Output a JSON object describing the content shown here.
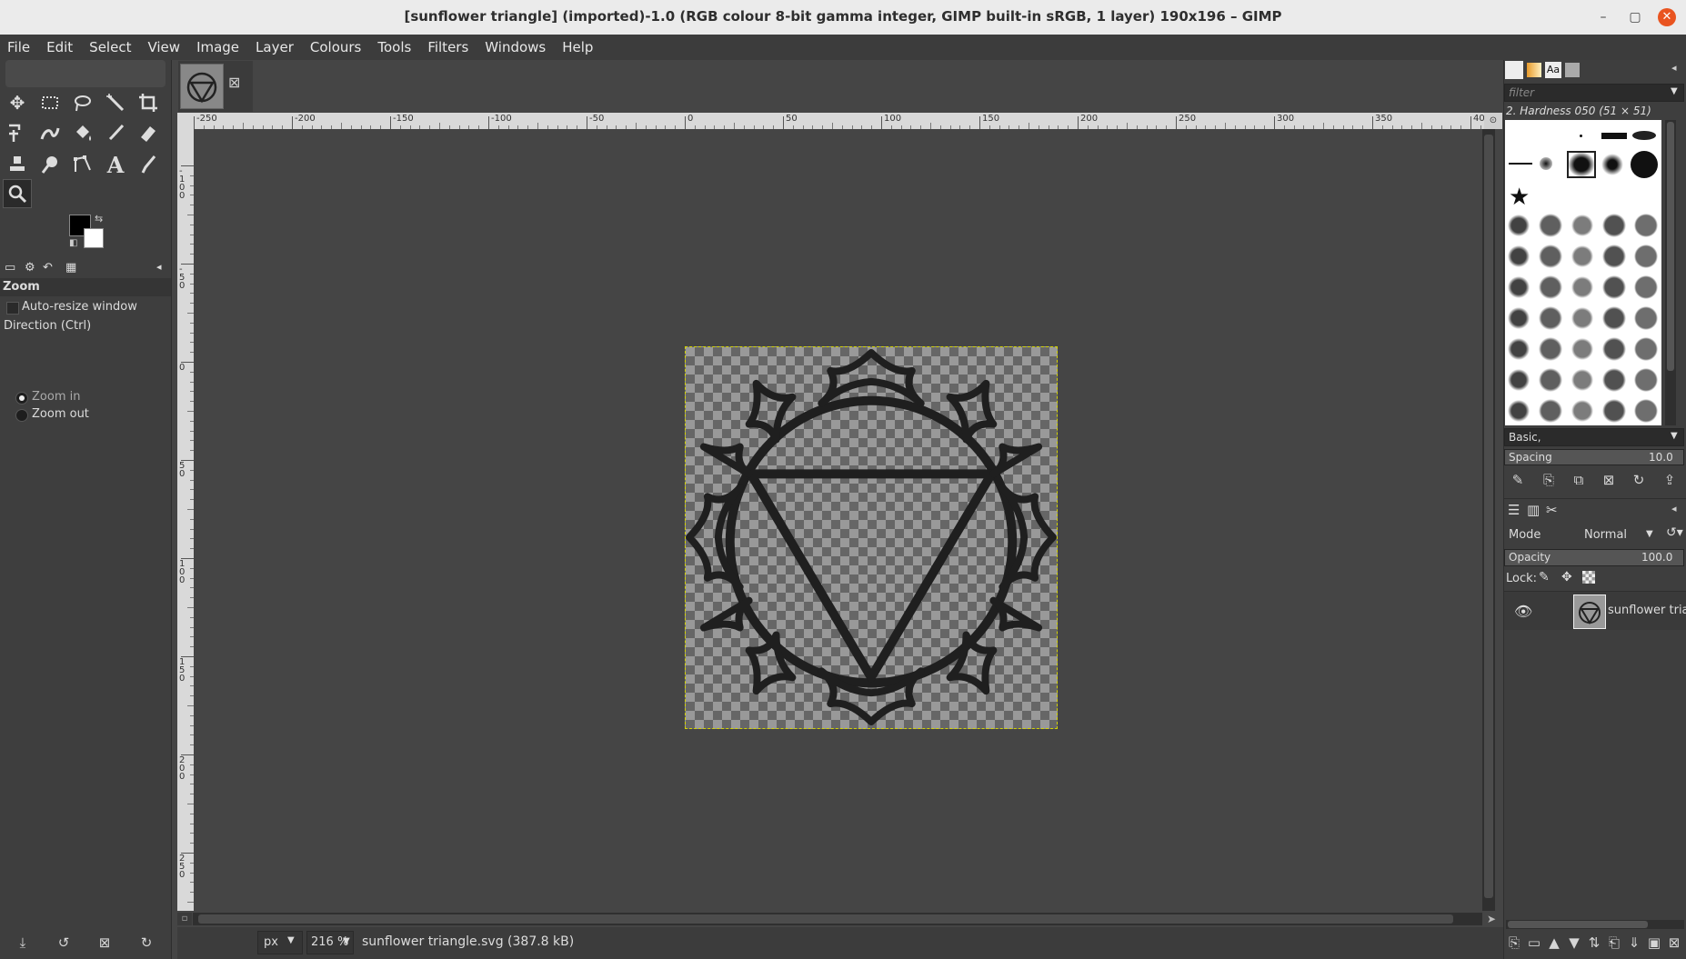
{
  "window": {
    "title": "[sunflower triangle] (imported)-1.0 (RGB colour 8-bit gamma integer, GIMP built-in sRGB, 1 layer) 190x196 – GIMP",
    "minimize_glyph": "–",
    "maximize_glyph": "▢",
    "close_glyph": "✕"
  },
  "menu": [
    "File",
    "Edit",
    "Select",
    "View",
    "Image",
    "Layer",
    "Colours",
    "Tools",
    "Filters",
    "Windows",
    "Help"
  ],
  "toolbox": {
    "tools": [
      "move-tool",
      "rect-select-tool",
      "free-select-tool",
      "fuzzy-select-tool",
      "crop-tool",
      "transform-tool",
      "warp-tool",
      "bucket-fill-tool",
      "paintbrush-tool",
      "eraser-tool",
      "clone-tool",
      "smudge-tool",
      "paths-tool",
      "text-tool",
      "color-picker-tool",
      "zoom-tool"
    ],
    "active_tool": "zoom-tool",
    "fg_color": "#000000",
    "bg_color": "#ffffff"
  },
  "tool_options": {
    "title": "Zoom",
    "auto_resize_label": "Auto-resize window",
    "direction_label": "Direction  (Ctrl)",
    "zoom_in_label": "Zoom in",
    "zoom_out_label": "Zoom out",
    "selected_direction": "Zoom in"
  },
  "canvas": {
    "tab_close_glyph": "⊠",
    "hruler_labels": [
      "-250",
      "-200",
      "-150",
      "-100",
      "-50",
      "0",
      "50",
      "100",
      "150",
      "200",
      "250",
      "300",
      "350",
      "40"
    ],
    "vruler_labels": [
      "-1 0 0",
      "-5 0",
      "0",
      "5 0",
      "1 0 0",
      "1 5 0",
      "2 0 0",
      "2 5 0"
    ],
    "image_name": "sunflower triangle"
  },
  "statusbar": {
    "unit": "px",
    "zoom": "216 %",
    "file_info": "sunflower triangle.svg (387.8 kB)"
  },
  "brushes": {
    "filter_placeholder": "filter",
    "current_brush": "2. Hardness 050 (51 × 51)",
    "tag_value": "Basic,",
    "spacing_label": "Spacing",
    "spacing_value": "10.0"
  },
  "layers": {
    "mode_label": "Mode",
    "mode_value": "Normal",
    "opacity_label": "Opacity",
    "opacity_value": "100.0",
    "lock_label": "Lock:",
    "layer_name": "sunflower trian"
  },
  "colors": {
    "accent_close": "#e95420",
    "selection_border": "#d4d400"
  }
}
